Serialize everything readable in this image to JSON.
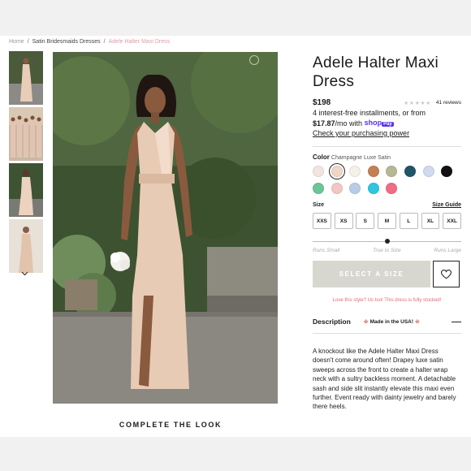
{
  "breadcrumb": {
    "home": "Home",
    "category": "Satin Bridesmaids Dresses",
    "current": "Adele Halter Maxi Dress"
  },
  "product": {
    "title": "Adele Halter Maxi Dress",
    "price": "$198",
    "rating_stars": 4,
    "reviews": "41 reviews",
    "installments_line1": "4 interest-free installments, or from",
    "installment_amount": "$17.87",
    "installments_line2": "/mo with",
    "shoppay_text": "shop",
    "shoppay_badge": "Pay",
    "check_power": "Check your purchasing power"
  },
  "color": {
    "label": "Color",
    "selected_name": "Champagne Luxe Satin",
    "swatches": [
      "#f3e4e2",
      "#f0d6c6",
      "#f4f1e9",
      "#c47f55",
      "#b8b795",
      "#1f5567",
      "#cfdaf0",
      "#111111",
      "#6cc596",
      "#f2c7c3",
      "#b9cbe6",
      "#2fc6df",
      "#ef6d87"
    ],
    "selected_index": 1
  },
  "size": {
    "label": "Size",
    "guide": "Size Guide",
    "options": [
      "XXS",
      "XS",
      "S",
      "M",
      "L",
      "XL",
      "XXL"
    ],
    "fit_labels": [
      "Runs Small",
      "True to Size",
      "Runs Large"
    ],
    "fit_value": 0.5
  },
  "cta": {
    "select_size": "SELECT A SIZE",
    "heart_icon": "heart-outline-icon"
  },
  "stocked_msg": "Love this style? Us too! This dress is fully stocked!",
  "description": {
    "title": "Description",
    "made_in": "Made in the USA!",
    "body": "A knockout like the Adele Halter Maxi Dress doesn't come around often! Drapey luxe satin sweeps across the front to create a halter wrap neck with a sultry backless moment. A detachable sash and side slit instantly elevate this maxi even further. Event ready with dainty jewelry and barely there heels."
  },
  "complete_look": "COMPLETE THE LOOK"
}
